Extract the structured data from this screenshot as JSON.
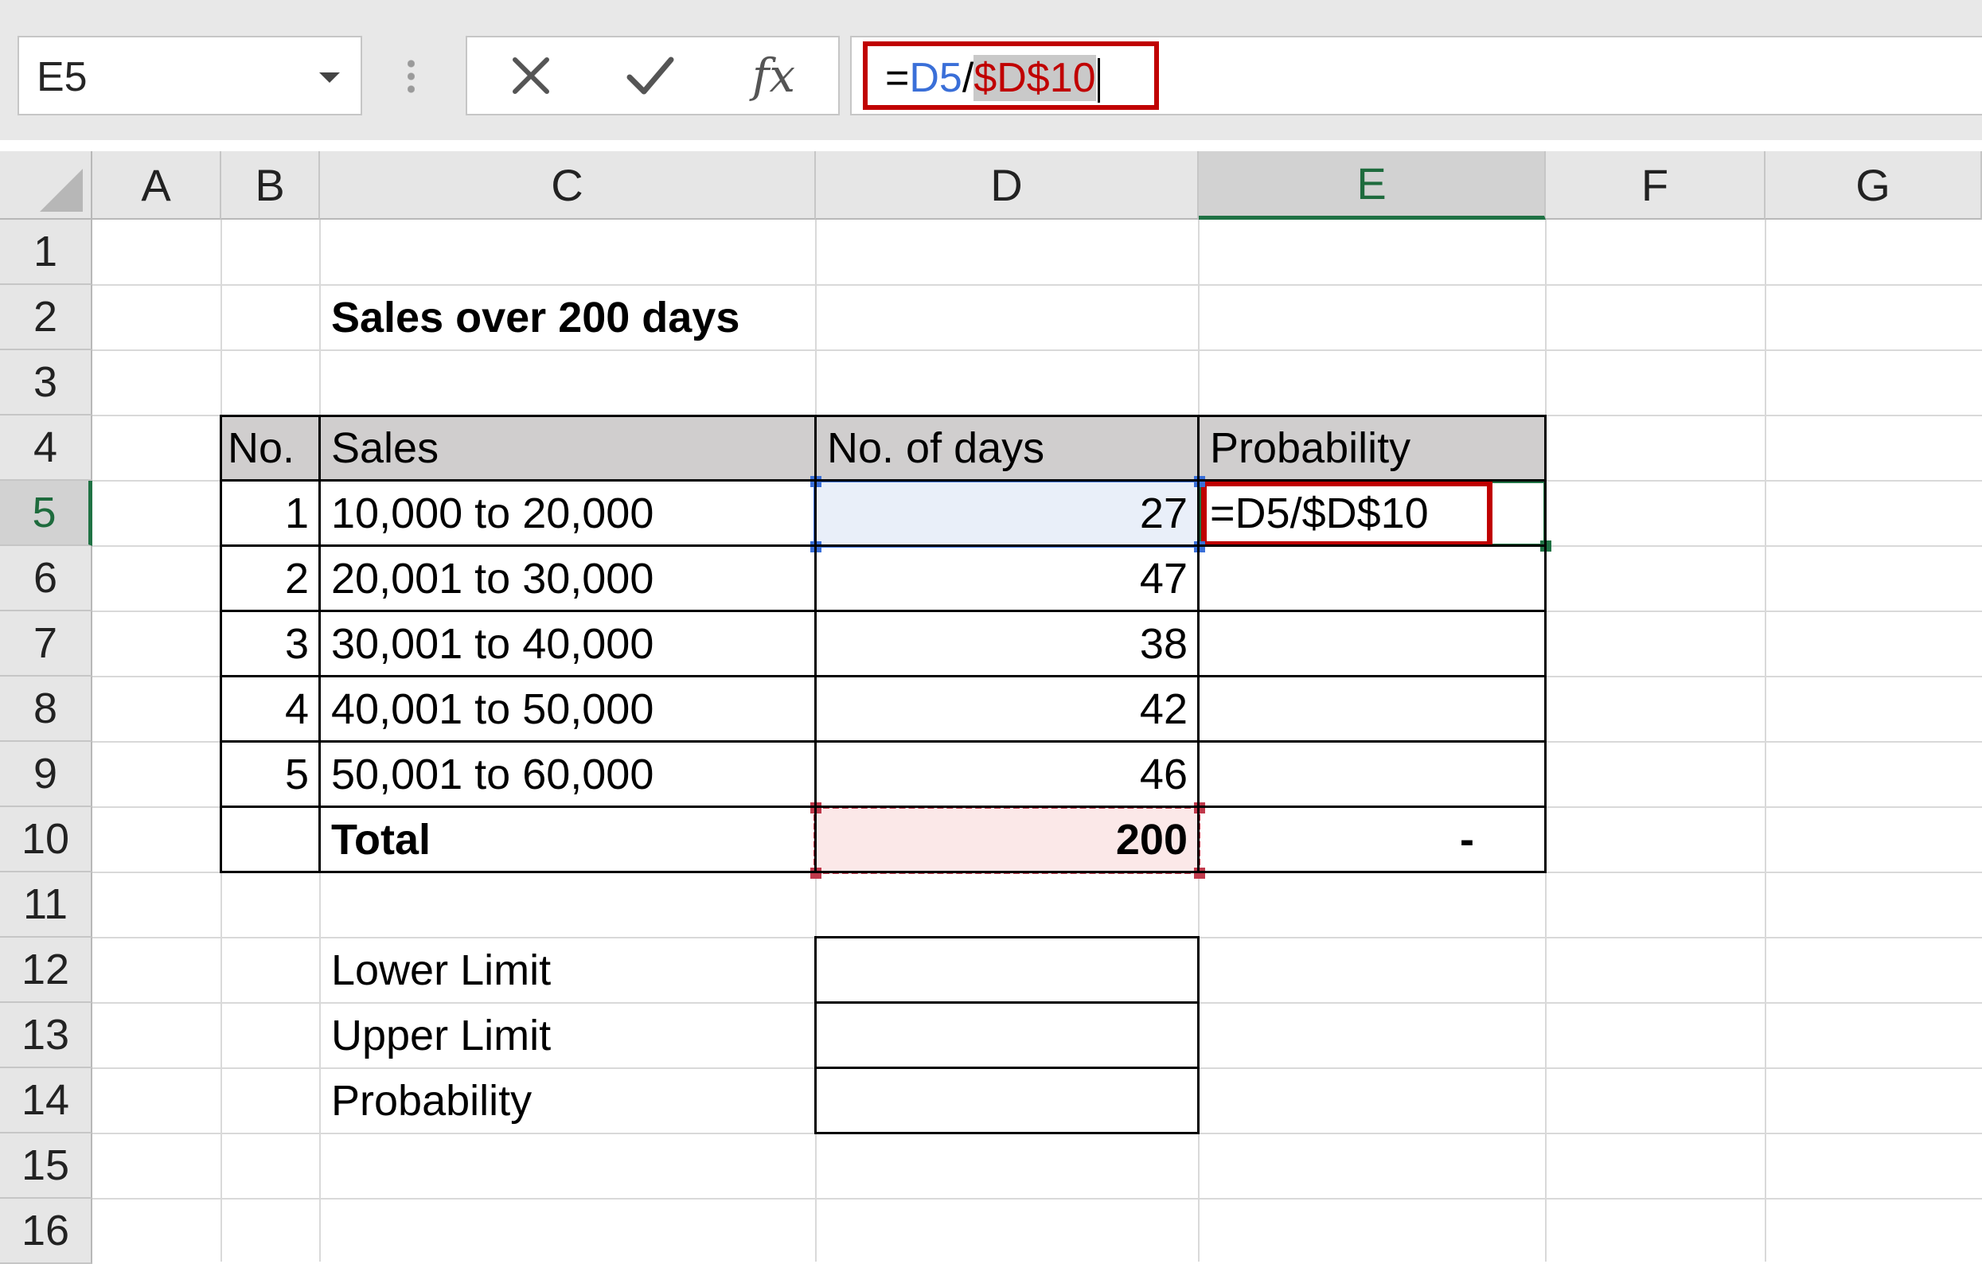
{
  "name_box": {
    "value": "E5"
  },
  "toolbar": {
    "cancel_icon": "cancel-x-icon",
    "enter_icon": "checkmark-icon",
    "fx_label": "fx"
  },
  "formula_bar": {
    "prefix": "=",
    "ref_relative": "D5",
    "slash": "/",
    "ref_absolute": "$D$10"
  },
  "columns": [
    "A",
    "B",
    "C",
    "D",
    "E",
    "F",
    "G"
  ],
  "active_column": "E",
  "rows": [
    "1",
    "2",
    "3",
    "4",
    "5",
    "6",
    "7",
    "8",
    "9",
    "10",
    "11",
    "12",
    "13",
    "14",
    "15",
    "16"
  ],
  "active_row": "5",
  "sheet": {
    "title": "Sales over 200 days",
    "table_headers": {
      "no": "No.",
      "sales": "Sales",
      "days": "No. of days",
      "probability": "Probability"
    },
    "table_rows": [
      {
        "no": "1",
        "sales": "10,000 to 20,000",
        "days": "27"
      },
      {
        "no": "2",
        "sales": "20,001 to 30,000",
        "days": "47"
      },
      {
        "no": "3",
        "sales": "30,001 to 40,000",
        "days": "38"
      },
      {
        "no": "4",
        "sales": "40,001 to 50,000",
        "days": "42"
      },
      {
        "no": "5",
        "sales": "50,001 to 60,000",
        "days": "46"
      }
    ],
    "editing_cell_formula": "=D5/$D$10",
    "total_label": "Total",
    "total_days": "200",
    "total_probability": "-",
    "limits": {
      "lower": "Lower Limit",
      "upper": "Upper Limit",
      "probability": "Probability"
    }
  },
  "colors": {
    "accent_green": "#1f7244",
    "highlight_red": "#c00000",
    "ref_blue": "#3a6fd8",
    "header_fill": "#d0cece"
  }
}
